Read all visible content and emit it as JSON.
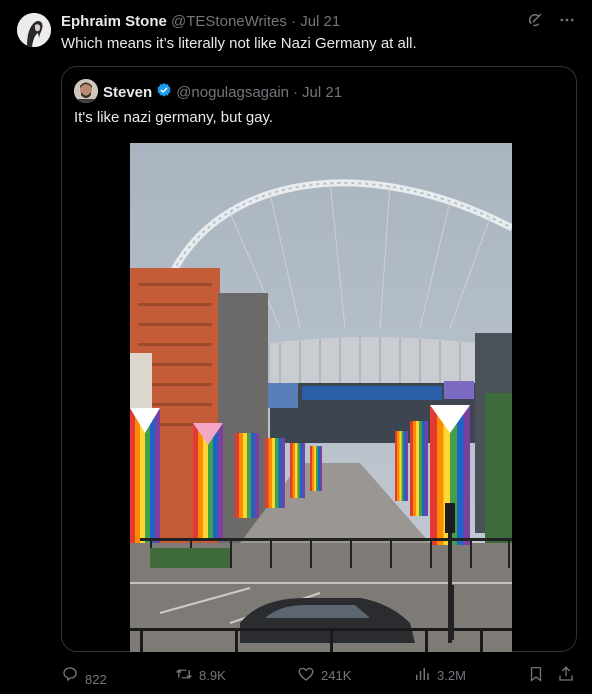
{
  "tweet": {
    "author_name": "Ephraim Stone",
    "author_handle": "@TEStoneWrites",
    "separator": "·",
    "date": "Jul 21",
    "text": "Which means it’s literally not like Nazi Germany at all."
  },
  "quoted": {
    "author_name": "Steven",
    "verified": true,
    "author_handle": "@nogulagsagain",
    "separator": "·",
    "date": "Jul 21",
    "text": "It's like nazi germany, but gay."
  },
  "actions": {
    "reply_count": "822",
    "repost_count": "8.9K",
    "like_count": "241K",
    "view_count": "3.2M"
  },
  "colors": {
    "background": "#000000",
    "text": "#e7e9ea",
    "muted": "#71767b",
    "border": "#2f3336",
    "verified": "#1d9bf0"
  },
  "icons": [
    "grok-icon",
    "more-icon",
    "verified-badge-icon",
    "reply-icon",
    "repost-icon",
    "like-icon",
    "views-icon",
    "bookmark-icon",
    "share-icon"
  ]
}
